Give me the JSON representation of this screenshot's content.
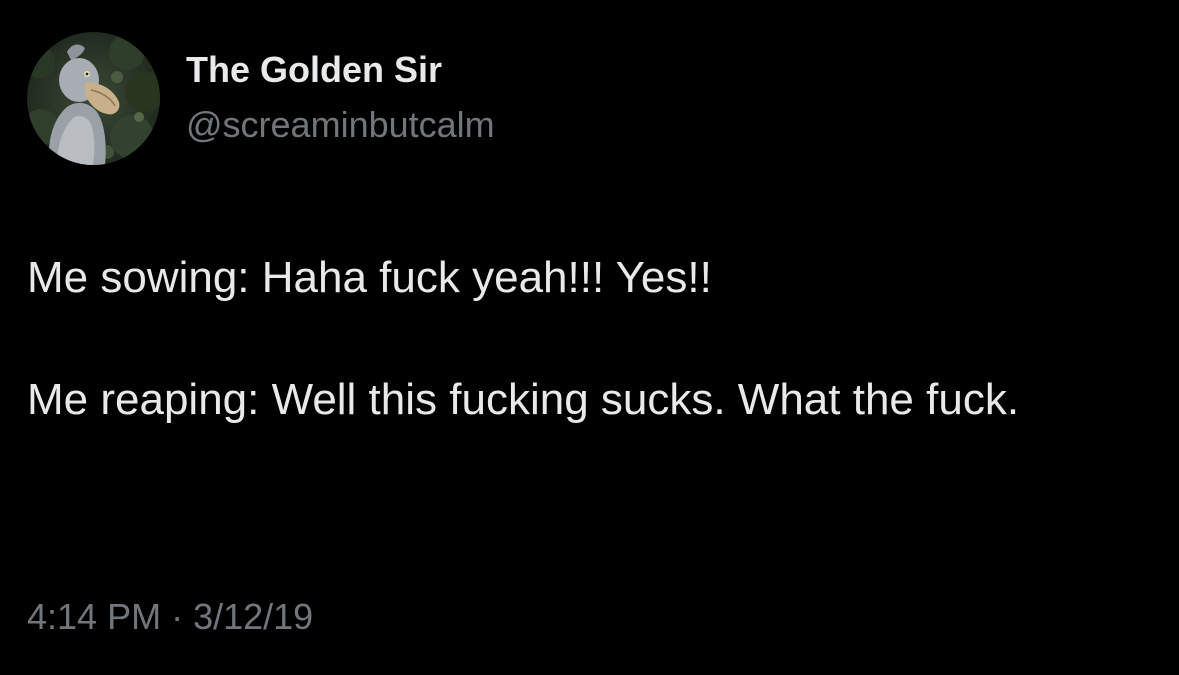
{
  "tweet": {
    "author": {
      "display_name": "The Golden Sir",
      "handle": "@screaminbutcalm",
      "avatar_icon": "shoebill-bird-avatar"
    },
    "text_paragraphs": [
      "Me sowing: Haha fuck yeah!!! Yes!!",
      "Me reaping: Well this fucking sucks. What the fuck."
    ],
    "time": "4:14 PM",
    "separator": "·",
    "date": "3/12/19"
  },
  "colors": {
    "background": "#000000",
    "primary_text": "#e7e9ea",
    "secondary_text": "#71767b"
  }
}
